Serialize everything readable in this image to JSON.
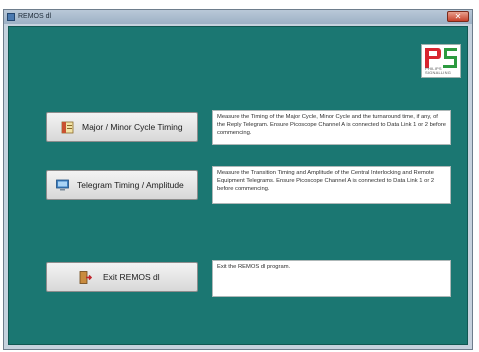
{
  "window": {
    "title": "REMOS dl",
    "close_glyph": "✕"
  },
  "logo": {
    "letters": "PS",
    "caption": "PHILIPS SIGNALLING",
    "colors": {
      "p": "#d8262f",
      "s": "#2c9a3f"
    }
  },
  "colors": {
    "background": "#1b7772",
    "button_face": "#e6e6e6",
    "description_box": "#ffffff"
  },
  "actions": [
    {
      "icon": "calendar-icon",
      "label": "Major / Minor Cycle Timing",
      "description": "Measure the Timing of the Major Cycle, Minor Cycle and the turnaround time, if any, of the Reply Telegram. Ensure Picoscope Channel A is connected to Data Link 1 or 2 before commencing."
    },
    {
      "icon": "monitor-icon",
      "label": "Telegram Timing / Amplitude",
      "description": "Measure the Transition Timing and Amplitude of the Central Interlocking and Remote Equipment Telegrams. Ensure Picoscope Channel A is connected to Data Link 1 or 2 before commencing."
    },
    {
      "icon": "exit-door-icon",
      "label": "Exit REMOS dl",
      "description": "Exit the REMOS dl program."
    }
  ]
}
